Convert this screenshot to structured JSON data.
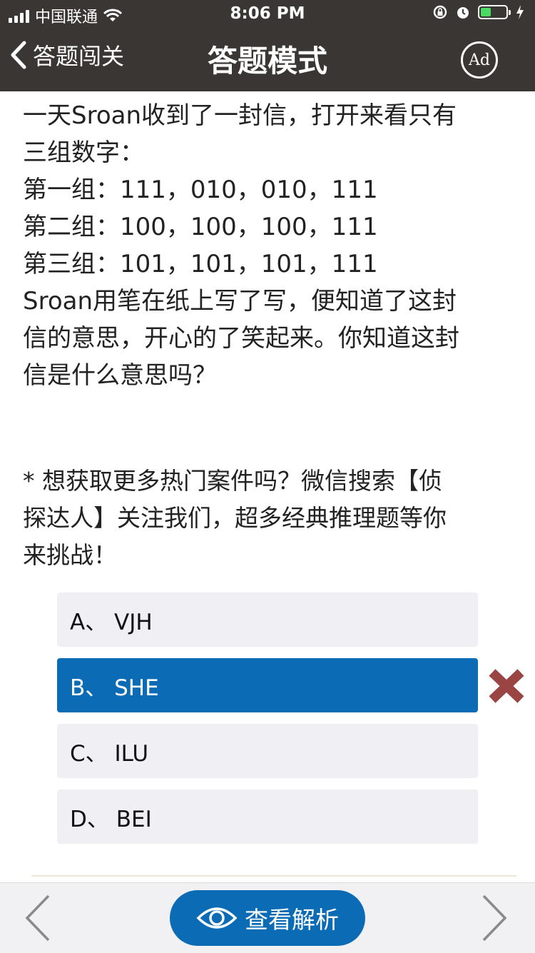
{
  "status_bar": {
    "carrier": "中国联通",
    "time": "8:06 PM"
  },
  "header": {
    "back_label": "答题闯关",
    "title": "答题模式",
    "ad_label": "Ad"
  },
  "question": {
    "lines": [
      "一天Sroan收到了一封信，打开来看只有",
      "三组数字：",
      "第一组：111，010，010，111",
      "第二组：100，100，100，111",
      "第三组：101，101，101，111",
      "Sroan用笔在纸上写了写，便知道了这封",
      "信的意思，开心的了笑起来。你知道这封",
      "信是什么意思吗？"
    ]
  },
  "promo": {
    "lines": [
      "* 想获取更多热门案件吗？微信搜索【侦",
      "探达人】关注我们，超多经典推理题等你",
      "来挑战！"
    ]
  },
  "options": [
    {
      "label": "A、 VJH"
    },
    {
      "label": "B、 SHE"
    },
    {
      "label": "C、 ILU"
    },
    {
      "label": "D、 BEI"
    }
  ],
  "selected_option_index": 1,
  "footer": {
    "analysis_label": "查看解析"
  },
  "colors": {
    "header_bg": "#3a3634",
    "accent": "#0b6bb5",
    "wrong": "#9b4444",
    "option_bg": "#efeff4"
  },
  "icons": [
    "back-chevron-icon",
    "ad-icon",
    "wrong-x-icon",
    "eye-icon",
    "prev-chevron-icon",
    "next-chevron-icon",
    "wifi-icon",
    "alarm-icon",
    "lock-rotation-icon",
    "battery-icon",
    "charging-icon",
    "signal-icon"
  ]
}
